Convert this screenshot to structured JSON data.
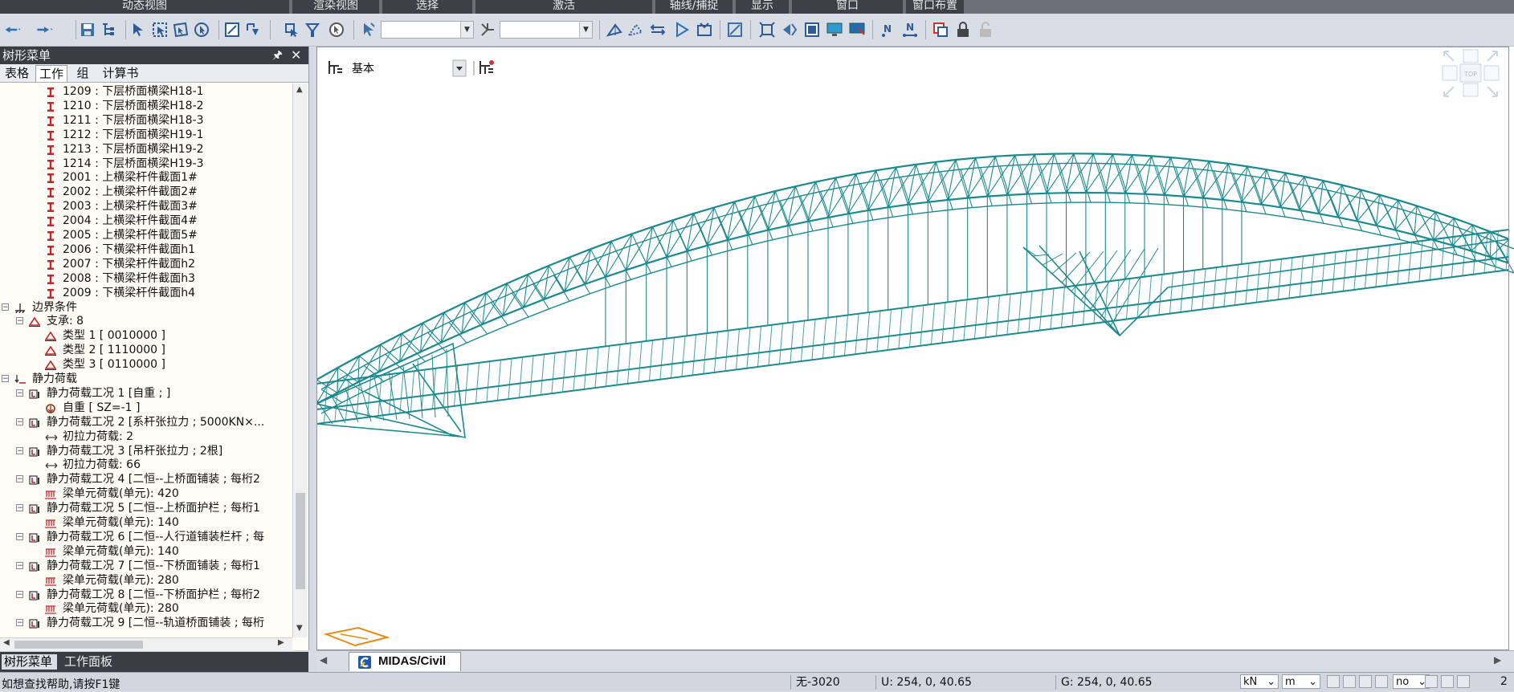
{
  "top_groups": [
    "动态视图",
    "渲染视图",
    "选择",
    "激活",
    "轴线/捕捉",
    "显示",
    "窗口",
    "窗口布置"
  ],
  "left_panel": {
    "title": "树形菜单",
    "pin_icon": "pin-icon",
    "close_glyph": "✕",
    "tabs": [
      "表格",
      "工作",
      "组",
      "计算书"
    ],
    "active_tab": "工作",
    "bottom_tabs": [
      "树形菜单",
      "工作面板"
    ],
    "tree": [
      {
        "text": "1209 : 下层桥面横梁H18-1",
        "icon": "section-i",
        "level": 3
      },
      {
        "text": "1210 : 下层桥面横梁H18-2",
        "icon": "section-i",
        "level": 3
      },
      {
        "text": "1211 : 下层桥面横梁H18-3",
        "icon": "section-i",
        "level": 3
      },
      {
        "text": "1212 : 下层桥面横梁H19-1",
        "icon": "section-i",
        "level": 3
      },
      {
        "text": "1213 : 下层桥面横梁H19-2",
        "icon": "section-i",
        "level": 3
      },
      {
        "text": "1214 : 下层桥面横梁H19-3",
        "icon": "section-i",
        "level": 3
      },
      {
        "text": "2001 : 上横梁杆件截面1#",
        "icon": "section-i",
        "level": 3
      },
      {
        "text": "2002 : 上横梁杆件截面2#",
        "icon": "section-i",
        "level": 3
      },
      {
        "text": "2003 : 上横梁杆件截面3#",
        "icon": "section-i",
        "level": 3
      },
      {
        "text": "2004 : 上横梁杆件截面4#",
        "icon": "section-i",
        "level": 3
      },
      {
        "text": "2005 : 上横梁杆件截面5#",
        "icon": "section-i",
        "level": 3
      },
      {
        "text": "2006 : 下横梁杆件截面h1",
        "icon": "section-i",
        "level": 3
      },
      {
        "text": "2007 : 下横梁杆件截面h2",
        "icon": "section-i",
        "level": 3
      },
      {
        "text": "2008 : 下横梁杆件截面h3",
        "icon": "section-i",
        "level": 3
      },
      {
        "text": "2009 : 下横梁杆件截面h4",
        "icon": "section-i",
        "level": 3
      },
      {
        "text": "边界条件",
        "icon": "boundary",
        "level": 1,
        "toggle": "⊟"
      },
      {
        "text": "支承: 8",
        "icon": "support",
        "level": 2,
        "toggle": "⊟"
      },
      {
        "text": "类型 1 [ 0010000 ]",
        "icon": "support",
        "level": 3
      },
      {
        "text": "类型 2 [ 1110000 ]",
        "icon": "support",
        "level": 3
      },
      {
        "text": "类型 3 [ 0110000 ]",
        "icon": "support",
        "level": 3
      },
      {
        "text": "静力荷载",
        "icon": "static-load",
        "level": 1,
        "toggle": "⊟"
      },
      {
        "text": "静力荷载工况 1 [自重 ; ]",
        "icon": "load-case",
        "level": 2,
        "toggle": "⊟"
      },
      {
        "text": "自重 [ SZ=-1 ]",
        "icon": "self-weight",
        "level": 3
      },
      {
        "text": "静力荷载工况 2 [系杆张拉力 ; 5000KN×...",
        "icon": "load-case",
        "level": 2,
        "toggle": "⊟"
      },
      {
        "text": "初拉力荷载: 2",
        "icon": "pretension",
        "level": 3
      },
      {
        "text": "静力荷载工况 3 [吊杆张拉力 ; 2根]",
        "icon": "load-case",
        "level": 2,
        "toggle": "⊟"
      },
      {
        "text": "初拉力荷载: 66",
        "icon": "pretension",
        "level": 3
      },
      {
        "text": "静力荷载工况 4 [二恒--上桥面铺装 ; 每桁2",
        "icon": "load-case",
        "level": 2,
        "toggle": "⊟"
      },
      {
        "text": "梁单元荷载(单元): 420",
        "icon": "beam-load",
        "level": 3
      },
      {
        "text": "静力荷载工况 5 [二恒--上桥面护栏 ; 每桁1",
        "icon": "load-case",
        "level": 2,
        "toggle": "⊟"
      },
      {
        "text": "梁单元荷载(单元): 140",
        "icon": "beam-load",
        "level": 3
      },
      {
        "text": "静力荷载工况 6 [二恒--人行道铺装栏杆 ; 每",
        "icon": "load-case",
        "level": 2,
        "toggle": "⊟"
      },
      {
        "text": "梁单元荷载(单元): 140",
        "icon": "beam-load",
        "level": 3
      },
      {
        "text": "静力荷载工况 7 [二恒--下桥面铺装 ; 每桁1",
        "icon": "load-case",
        "level": 2,
        "toggle": "⊟"
      },
      {
        "text": "梁单元荷载(单元): 280",
        "icon": "beam-load",
        "level": 3
      },
      {
        "text": "静力荷载工况 8 [二恒--下桥面护栏 ; 每桁2",
        "icon": "load-case",
        "level": 2,
        "toggle": "⊟"
      },
      {
        "text": "梁单元荷载(单元): 280",
        "icon": "beam-load",
        "level": 3
      },
      {
        "text": "静力荷载工况 9 [二恒--轨道桥面铺装 ; 每桁",
        "icon": "load-case",
        "level": 2,
        "toggle": "⊟"
      }
    ]
  },
  "viewport": {
    "layer_label": "基本",
    "view_cube_top": "TOP",
    "model_color": "#1b8a8f"
  },
  "doc_tab": {
    "label": "MIDAS/Civil",
    "icon": "midas-civil-icon"
  },
  "status": {
    "help": "如想查找帮助,请按F1键",
    "element": "无-3020",
    "u": "U: 254, 0, 40.65",
    "g": "G: 254, 0, 40.65",
    "force_unit": "kN",
    "length_unit": "m",
    "filter": "no",
    "trailing": "2"
  },
  "colors": {
    "accent_red": "#c0282d",
    "bridge": "#1b8a8f",
    "panel_header": "#3a3d44"
  }
}
